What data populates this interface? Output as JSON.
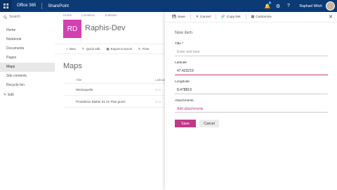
{
  "suitebar": {
    "app_launcher": "waffle-icon",
    "office": "Office 365",
    "product": "SharePoint",
    "notifications_count": "1",
    "user_name": "Raphael Witch"
  },
  "leftnav": {
    "search_placeholder": "Search",
    "items": [
      {
        "label": "Home"
      },
      {
        "label": "Notebook"
      },
      {
        "label": "Documents"
      },
      {
        "label": "Pages"
      },
      {
        "label": "Maps"
      },
      {
        "label": "Site contents"
      },
      {
        "label": "Recycle bin"
      }
    ],
    "active_index": 4,
    "edit_label": "Edit"
  },
  "site": {
    "breadcrumbs": [
      "Home",
      "Locations",
      "Subsites"
    ],
    "logo_initials": "RD",
    "title": "Raphis-Dev",
    "commands": {
      "new": "New",
      "quick_edit": "Quick edit",
      "export": "Export to Excel",
      "flow": "Flow"
    },
    "list_title": "Maps",
    "columns": [
      "Title",
      "Latitude"
    ],
    "rows": [
      {
        "title": "Weinsquelle",
        "lat": "47.4"
      },
      {
        "title": "Produktion Blatter 61 Im Plas gross",
        "lat": "47.4"
      }
    ]
  },
  "panel": {
    "toolbar": {
      "save": "Save",
      "cancel": "Cancel",
      "copy_link": "Copy link",
      "customize": "Customize"
    },
    "form_title": "New item",
    "fields": {
      "title_label": "Title *",
      "title_placeholder": "Enter text here",
      "lat_label": "Latitude",
      "lat_value": "47.423219",
      "lon_label": "Longitude",
      "lon_value": "8.478819",
      "attach_label": "Attachments",
      "attach_link": "Add attachments"
    },
    "save_button": "Save",
    "cancel_button": "Cancel"
  },
  "colors": {
    "suitebar": "#0b3a74",
    "accent": "#c2378a",
    "site_logo": "#d43fb1"
  }
}
